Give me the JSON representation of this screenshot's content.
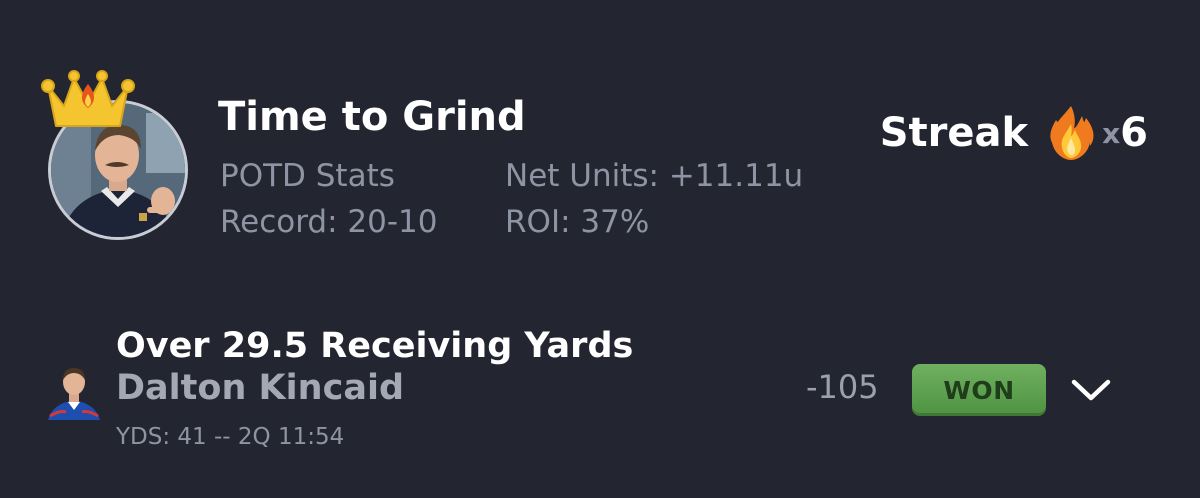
{
  "profile": {
    "name": "Time to Grind",
    "avatar_icon": "profile-photo",
    "crown_icon": "crown-flame-icon"
  },
  "stats": {
    "potd_label": "POTD Stats",
    "net_units": "Net Units: +11.11u",
    "record": "Record: 20-10",
    "roi": "ROI: 37%"
  },
  "streak": {
    "label": "Streak",
    "icon": "fire-icon",
    "multiplier": "x",
    "count": "6"
  },
  "pick": {
    "title": "Over 29.5 Receiving Yards",
    "player": "Dalton Kincaid",
    "live_stat": "YDS: 41 -- 2Q 11:54",
    "odds": "-105",
    "result": "WON",
    "result_color": "#5ea24f",
    "expand_icon": "chevron-down-icon"
  }
}
